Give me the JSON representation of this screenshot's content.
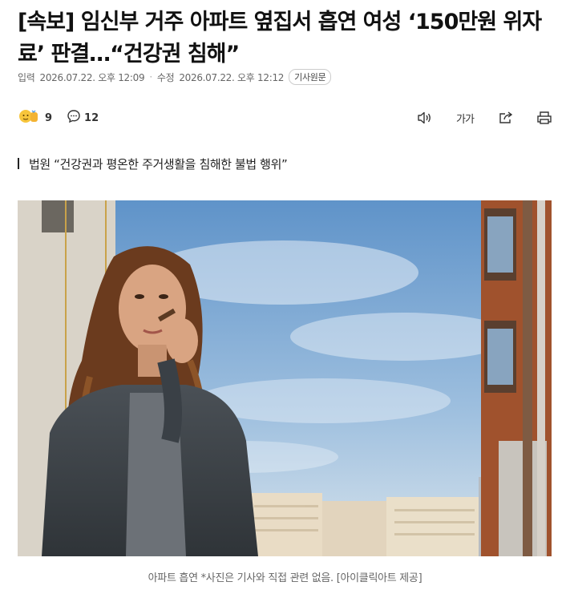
{
  "article": {
    "headline": "[속보] 임신부 거주 아파트 옆집서 흡연 여성 ‘150만원 위자료’ 판결…“건강권 침해”",
    "meta": {
      "published_label": "입력",
      "published": "2026.07.22. 오후 12:09",
      "modified_label": "수정",
      "modified": "2026.07.22. 오후 12:12",
      "origin_button": "기사원문"
    },
    "toolbar": {
      "reaction_count": "9",
      "comment_count": "12",
      "font_size_label": "가가"
    },
    "subheadline": "법원 “건강권과 평온한 주거생활을 침해한 불법 행위”",
    "caption": "아파트 흡연 *사진은 기사와 직접 관련 없음. [아이클릭아트 제공]"
  },
  "colors": {
    "text": "#111111",
    "meta": "#666666",
    "border": "#cccccc"
  },
  "icons": [
    "reaction-emoji-icon",
    "comment-icon",
    "speaker-icon",
    "font-size-icon",
    "share-icon",
    "print-icon"
  ]
}
